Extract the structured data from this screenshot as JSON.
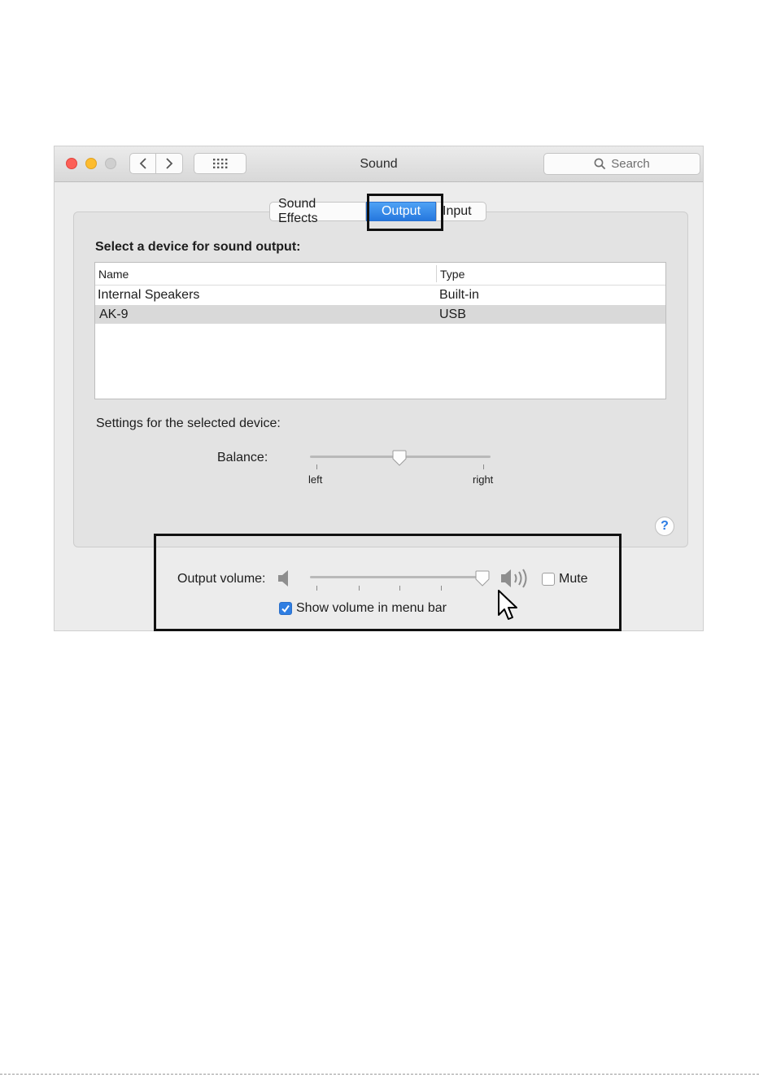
{
  "window": {
    "title": "Sound",
    "search_placeholder": "Search"
  },
  "tabs": [
    {
      "label": "Sound Effects",
      "selected": false
    },
    {
      "label": "Output",
      "selected": true
    },
    {
      "label": "Input",
      "selected": false
    }
  ],
  "output": {
    "heading": "Select a device for sound output:",
    "columns": [
      "Name",
      "Type"
    ],
    "devices": [
      {
        "name": "Internal Speakers",
        "type": "Built-in",
        "selected": false
      },
      {
        "name": "AK-9",
        "type": "USB",
        "selected": true
      }
    ],
    "settings_heading": "Settings for the selected device:",
    "balance_label": "Balance:",
    "balance_left": "left",
    "balance_right": "right",
    "balance_value": 0.5
  },
  "volume": {
    "label": "Output volume:",
    "value": 0.95,
    "mute_label": "Mute",
    "mute_checked": false,
    "show_in_menu_bar_label": "Show volume in menu bar",
    "show_in_menu_bar_checked": true
  },
  "help_label": "?",
  "colors": {
    "accent": "#2f7ee2",
    "close": "#fc5f57",
    "minimize": "#fdbc2e",
    "zoom_inactive": "#cfcfcf",
    "highlight_box": "#111111"
  }
}
